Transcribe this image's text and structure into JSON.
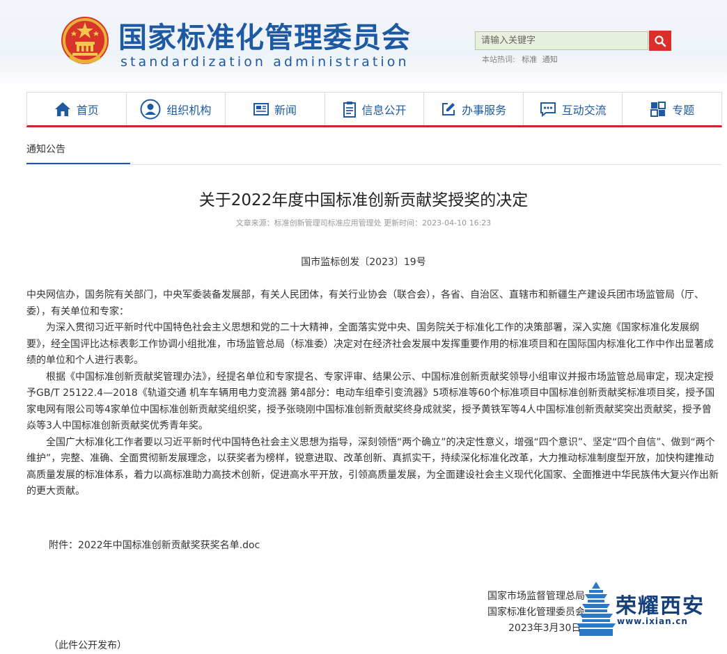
{
  "header": {
    "title_cn": "国家标准化管理委员会",
    "title_en": "standardization administration",
    "search_placeholder": "请输入关键字",
    "hot_label": "本站热词:",
    "hot_words": [
      "标准",
      "通知"
    ]
  },
  "nav": {
    "items": [
      {
        "label": "首页",
        "icon": "home-icon"
      },
      {
        "label": "组织机构",
        "icon": "user-icon"
      },
      {
        "label": "新闻",
        "icon": "newspaper-icon"
      },
      {
        "label": "信息公开",
        "icon": "clipboard-icon"
      },
      {
        "label": "办事服务",
        "icon": "edit-icon"
      },
      {
        "label": "互动交流",
        "icon": "chat-icon"
      },
      {
        "label": "专题",
        "icon": "topics-icon"
      }
    ]
  },
  "breadcrumb": "通知公告",
  "article": {
    "title": "关于2022年度中国标准创新贡献奖授奖的决定",
    "meta": "文章来源：标准创新管理司标准应用管理处 更新时间：2023-04-10 16:23",
    "doc_number": "国市监标创发〔2023〕19号",
    "addressee": "中央网信办，国务院有关部门，中央军委装备发展部，有关人民团体，有关行业协会（联合会），各省、自治区、直辖市和新疆生产建设兵团市场监管局（厅、委），有关单位和专家：",
    "paragraphs": [
      "为深入贯彻习近平新时代中国特色社会主义思想和党的二十大精神，全面落实党中央、国务院关于标准化工作的决策部署，深入实施《国家标准化发展纲要》，经全国评比达标表彰工作协调小组批准，市场监管总局（标准委）决定对在经济社会发展中发挥重要作用的标准项目和在国际国内标准化工作中作出显著成绩的单位和个人进行表彰。",
      "根据《中国标准创新贡献奖管理办法》，经提名单位和专家提名、专家评审、结果公示、中国标准创新贡献奖领导小组审议并报市场监管总局审定，现决定授予GB/T 25122.4—2018《轨道交通 机车车辆用电力变流器 第4部分：电动车组牵引变流器》5项标准等60个标准项目中国标准创新贡献奖标准项目奖，授予国家电网有限公司等4家单位中国标准创新贡献奖组织奖，授予张晓刚中国标准创新贡献奖终身成就奖，授予黄铁军等4人中国标准创新贡献奖突出贡献奖，授予曾焱等3人中国标准创新贡献奖优秀青年奖。",
      "全国广大标准化工作者要以习近平新时代中国特色社会主义思想为指导，深刻领悟“两个确立”的决定性意义，增强“四个意识”、坚定“四个自信”、做到“两个维护”，完整、准确、全面贯彻新发展理念，以获奖者为榜样，锐意进取、改革创新、真抓实干，持续深化标准化改革，大力推动标准制度型开放，加快构建推动高质量发展的标准体系，着力以高标准助力高技术创新，促进高水平开放，引领高质量发展，为全面建设社会主义现代化国家、全面推进中华民族伟大复兴作出新的更大贡献。"
    ],
    "attachment": "附件：2022年中国标准创新贡献奖获奖名单.doc",
    "signers": [
      "国家市场监督管理总局",
      "国家标准化管理委员会"
    ],
    "date": "2023年3月30日",
    "publish_note": "（此件公开发布）"
  },
  "watermark": {
    "text": "荣耀西安",
    "url": "www.ixian.cn"
  },
  "colors": {
    "brand_blue": "#1d5aa3",
    "accent_red": "#c8262b"
  }
}
